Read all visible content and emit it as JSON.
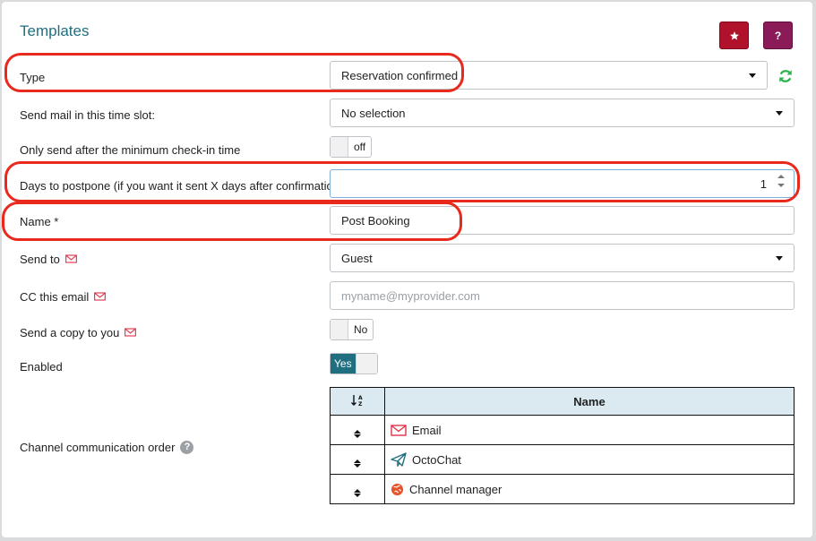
{
  "header": {
    "title": "Templates",
    "favorite_icon": "star-icon",
    "help_label": "?"
  },
  "form": {
    "type": {
      "label": "Type",
      "value": "Reservation confirmed",
      "refresh_icon": "refresh-icon"
    },
    "time_slot": {
      "label": "Send mail in this time slot:",
      "value": "No selection"
    },
    "min_checkin": {
      "label": "Only send after the minimum check-in time",
      "toggle": "off"
    },
    "postpone": {
      "label": "Days to postpone (if you want it sent X days after confirmation)",
      "value": "1"
    },
    "name": {
      "label": "Name *",
      "value": "Post Booking"
    },
    "send_to": {
      "label": "Send to",
      "value": "Guest"
    },
    "cc": {
      "label": "CC this email",
      "placeholder": "myname@myprovider.com"
    },
    "copy_to_you": {
      "label": "Send a copy to you",
      "toggle": "No"
    },
    "enabled": {
      "label": "Enabled",
      "toggle": "Yes"
    },
    "channel_order": {
      "label": "Channel communication order",
      "table": {
        "sort_header_icon": "sort-alpha-icon",
        "name_header": "Name",
        "rows": [
          {
            "name": "Email",
            "icon": "envelope-icon"
          },
          {
            "name": "OctoChat",
            "icon": "paper-plane-icon"
          },
          {
            "name": "Channel manager",
            "icon": "globe-icon"
          }
        ]
      }
    }
  },
  "colors": {
    "title": "#1f6f80",
    "favorite_button": "#b0112b",
    "help_button": "#8b1a58",
    "highlight": "#e8291c",
    "refresh": "#2bb24c",
    "toggle_on": "#1f6f80",
    "table_header": "#dbe9f0"
  }
}
